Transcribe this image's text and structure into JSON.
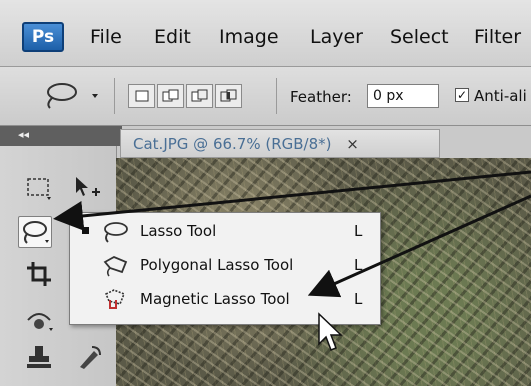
{
  "app": {
    "logo": "Ps"
  },
  "menu": [
    "File",
    "Edit",
    "Image",
    "Layer",
    "Select",
    "Filter"
  ],
  "options": {
    "feather_label": "Feather:",
    "feather_value": "0 px",
    "anti_alias_label": "Anti-ali",
    "anti_alias_checked": "✓"
  },
  "panel": {
    "collapse": "◂◂"
  },
  "document": {
    "tab_title": "Cat.JPG @ 66.7% (RGB/8*)",
    "close": "×"
  },
  "flyout": {
    "items": [
      {
        "label": "Lasso Tool",
        "shortcut": "L",
        "icon": "lasso-icon"
      },
      {
        "label": "Polygonal Lasso Tool",
        "shortcut": "L",
        "icon": "polygonal-lasso-icon"
      },
      {
        "label": "Magnetic Lasso Tool",
        "shortcut": "L",
        "icon": "magnetic-lasso-icon"
      }
    ]
  },
  "colors": {
    "ps_blue": "#1d5fa8",
    "arrow": "#111111"
  }
}
